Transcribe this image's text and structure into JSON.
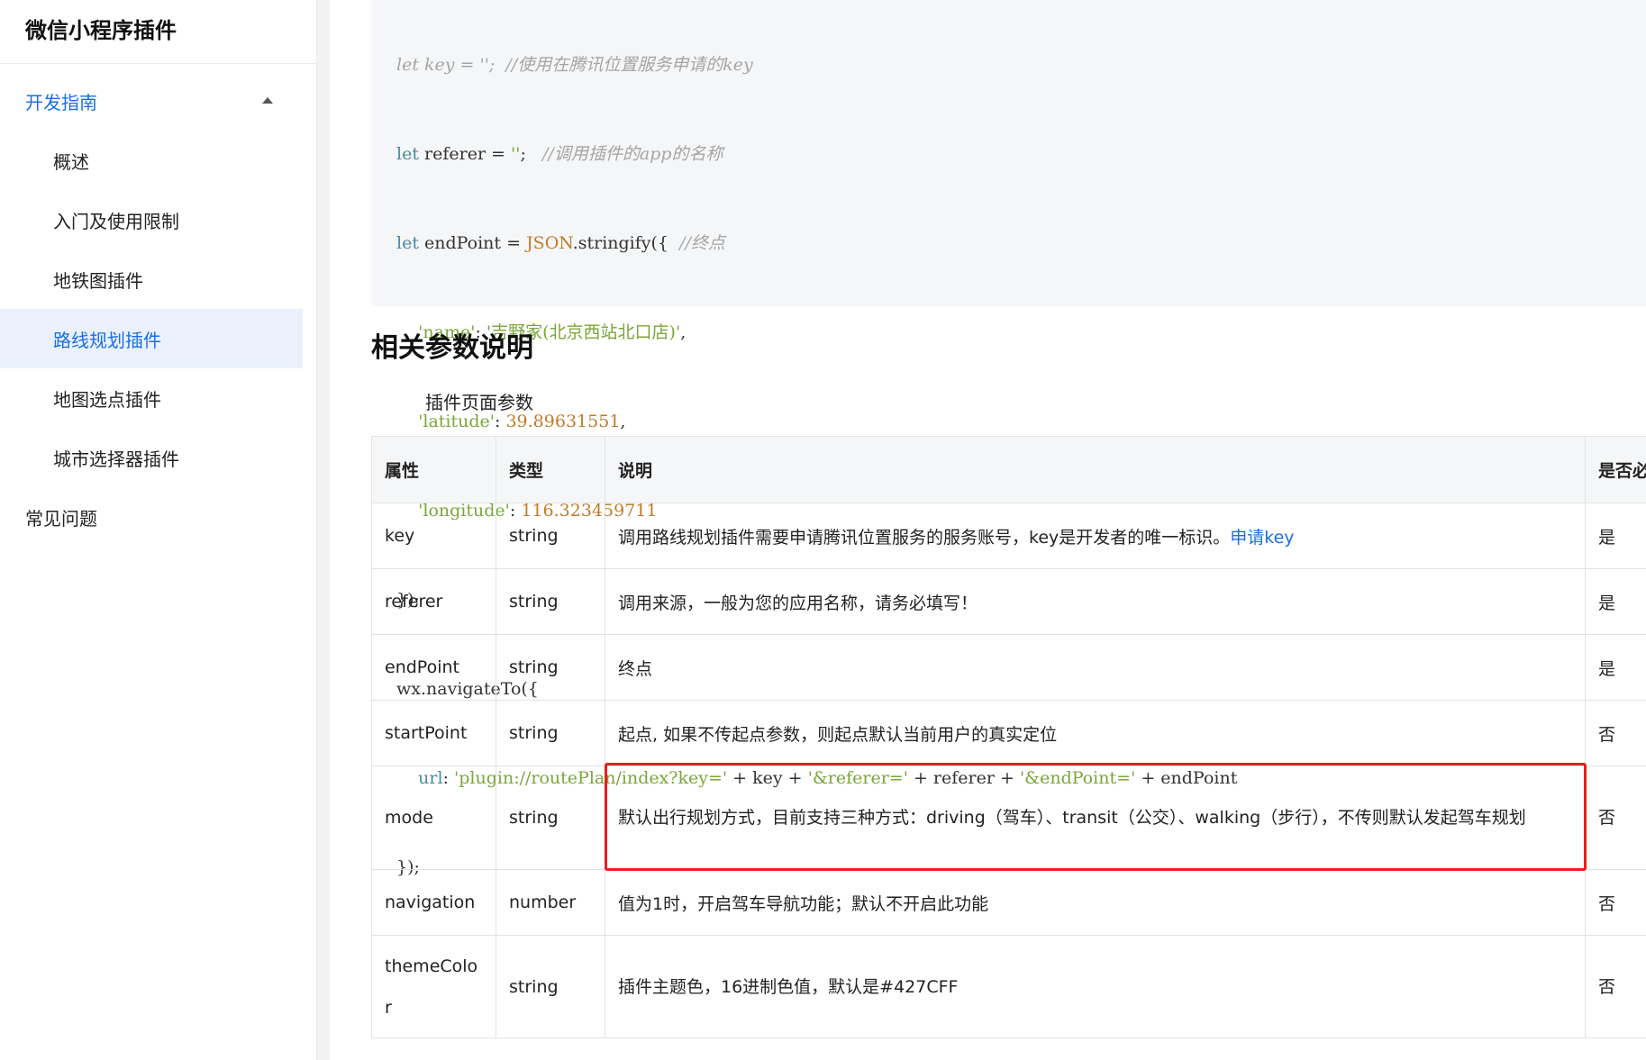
{
  "sidebar": {
    "title": "微信小程序插件",
    "group": "开发指南",
    "items": [
      {
        "label": "概述"
      },
      {
        "label": "入门及使用限制"
      },
      {
        "label": "地铁图插件"
      },
      {
        "label": "路线规划插件"
      },
      {
        "label": "地图选点插件"
      },
      {
        "label": "城市选择器插件"
      }
    ],
    "faq": "常见问题"
  },
  "code": {
    "line1": "let key = '';  //使用在腾讯位置服务申请的key",
    "line2_kw": "let",
    "line2_var": " referer = ",
    "line2_str": "''",
    "line2_rest": ";   ",
    "line2_cm": "//调用插件的app的名称",
    "line3_kw": "let",
    "line3_var": " endPoint = ",
    "line3_obj": "JSON",
    "line3_rest": ".stringify({  ",
    "line3_cm": "//终点",
    "line4_key": "'name'",
    "line4_sep": ": ",
    "line4_val": "'吉野家(北京西站北口店)'",
    "line4_end": ",",
    "line5_key": "'latitude'",
    "line5_sep": ": ",
    "line5_val": "39.89631551",
    "line5_end": ",",
    "line6_key": "'longitude'",
    "line6_sep": ": ",
    "line6_val": "116.323459711",
    "line7": "});",
    "line8": "wx.navigateTo({",
    "line9_key": "url",
    "line9_sep": ": ",
    "line9_s1": "'plugin://routePlan/index?key='",
    "line9_p1": " + key + ",
    "line9_s2": "'&referer='",
    "line9_p2": " + referer + ",
    "line9_s3": "'&endPoint='",
    "line9_p3": " + endPoint",
    "line10": "});"
  },
  "section": {
    "title": "相关参数说明",
    "subtitle": "插件页面参数"
  },
  "table": {
    "headers": [
      "属性",
      "类型",
      "说明",
      "是否必"
    ],
    "rows": [
      {
        "attr": "key",
        "type": "string",
        "desc": "调用路线规划插件需要申请腾讯位置服务的服务账号，key是开发者的唯一标识。",
        "link": "申请key",
        "req": "是"
      },
      {
        "attr": "referer",
        "type": "string",
        "desc": "调用来源，一般为您的应用名称，请务必填写！",
        "req": "是"
      },
      {
        "attr": "endPoint",
        "type": "string",
        "desc": "终点",
        "req": "是"
      },
      {
        "attr": "startPoint",
        "type": "string",
        "desc": "起点, 如果不传起点参数，则起点默认当前用户的真实定位",
        "req": "否"
      },
      {
        "attr": "mode",
        "type": "string",
        "desc": "默认出行规划方式，目前支持三种方式：driving（驾车）、transit（公交）、walking（步行），不传则默认发起驾车规划",
        "req": "否"
      },
      {
        "attr": "navigation",
        "type": "number",
        "desc": "值为1时，开启驾车导航功能；默认不开启此功能",
        "req": "否"
      },
      {
        "attr": "themeColor",
        "type": "string",
        "desc": "插件主题色，16进制色值，默认是#427CFF",
        "req": "否"
      }
    ]
  },
  "colors": {
    "accent": "#1a6ee8",
    "highlight": "#ee1c1c"
  }
}
